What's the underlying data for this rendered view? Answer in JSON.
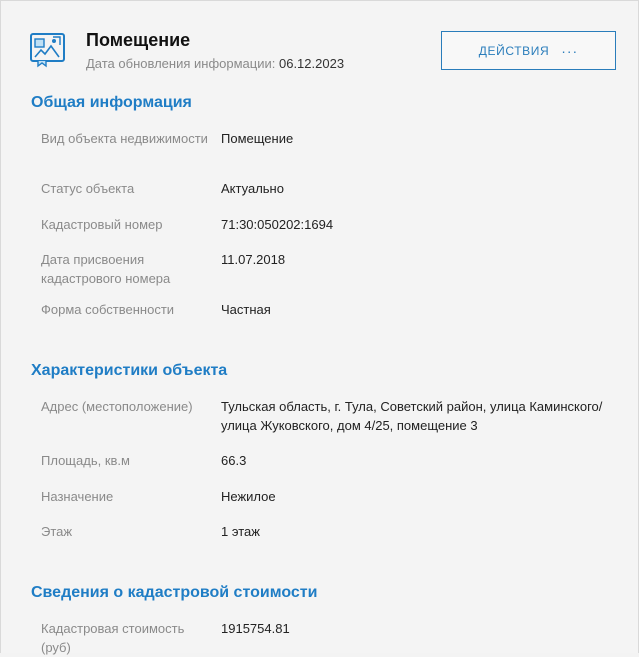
{
  "header": {
    "title": "Помещение",
    "updated_label": "Дата обновления информации:",
    "updated_value": "06.12.2023",
    "actions_label": "ДЕЙСТВИЯ",
    "actions_dots": "···",
    "logo_icon": "building-document-icon"
  },
  "colors": {
    "accent": "#1f7dc5",
    "label": "#8a8a8a",
    "text": "#222222"
  },
  "general": {
    "title": "Общая информация",
    "rows": [
      {
        "label": "Вид объекта недвижимости",
        "value": "Помещение"
      },
      {
        "label": "Статус объекта",
        "value": "Актуально"
      },
      {
        "label": "Кадастровый номер",
        "value": "71:30:050202:1694"
      },
      {
        "label": "Дата присвоения кадастрового номера",
        "value": "11.07.2018"
      },
      {
        "label": "Форма собственности",
        "value": "Частная"
      }
    ]
  },
  "characteristics": {
    "title": "Характеристики объекта",
    "rows": [
      {
        "label": "Адрес (местоположение)",
        "value": "Тульская область, г. Тула, Советский район, улица Каминского/ улица Жуковского, дом 4/25, помещение 3"
      },
      {
        "label": "Площадь, кв.м",
        "value": "66.3"
      },
      {
        "label": "Назначение",
        "value": "Нежилое"
      },
      {
        "label": "Этаж",
        "value": "1 этаж"
      }
    ]
  },
  "cadastral_cost": {
    "title": "Сведения о кадастровой стоимости",
    "rows": [
      {
        "label": "Кадастровая стоимость (руб)",
        "value": "1915754.81"
      }
    ]
  }
}
